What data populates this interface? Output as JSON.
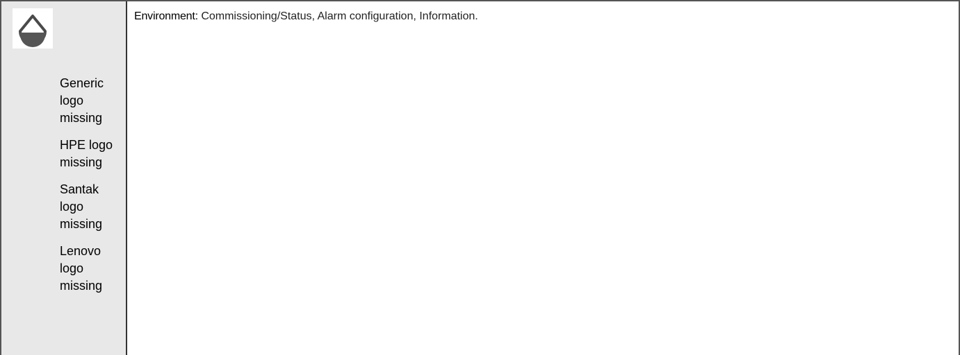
{
  "sidebar": {
    "logo_icon": "water-drop-level-icon",
    "missing_logos": [
      "Generic logo missing",
      "HPE logo missing",
      "Santak logo missing",
      "Lenovo logo missing"
    ]
  },
  "main": {
    "environment_label": "Environment:",
    "environment_text": " Commissioning/Status, Alarm configuration, Information."
  },
  "colors": {
    "sidebar_bg": "#e8e8e8",
    "border": "#333333",
    "icon_fill": "#555555"
  }
}
